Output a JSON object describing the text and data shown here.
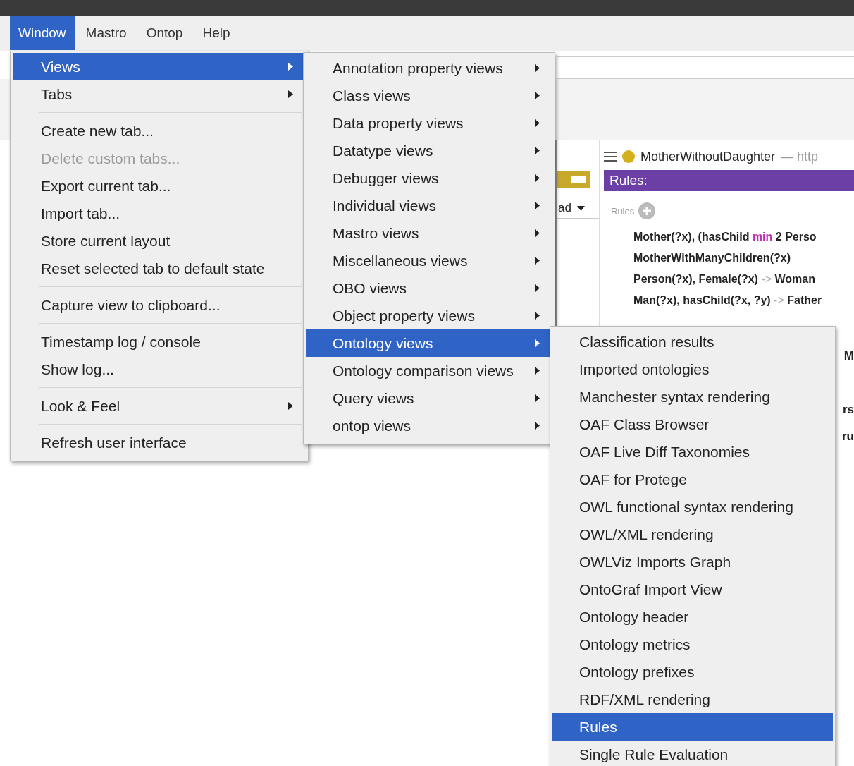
{
  "menubar": [
    {
      "label": "Window",
      "selected": true
    },
    {
      "label": "Mastro",
      "selected": false
    },
    {
      "label": "Ontop",
      "selected": false
    },
    {
      "label": "Help",
      "selected": false
    }
  ],
  "background": {
    "dropdown": "ad",
    "panel": {
      "title": "MotherWithoutDaughter",
      "title_suffix": "— http",
      "header": "Rules:",
      "section_label": "Rules",
      "rules": [
        {
          "parts": [
            {
              "text": "Mother(?x), (hasChild ",
              "kind": "plain"
            },
            {
              "text": "min",
              "kind": "keyword"
            },
            {
              "text": " 2 Perso",
              "kind": "plain"
            }
          ]
        },
        {
          "parts": [
            {
              "text": "MotherWithManyChildren(?x)",
              "kind": "plain"
            }
          ]
        },
        {
          "parts": [
            {
              "text": "Person(?x), Female(?x)",
              "kind": "plain"
            },
            {
              "text": " -> ",
              "kind": "arrow"
            },
            {
              "text": "Woman",
              "kind": "plain"
            }
          ]
        },
        {
          "parts": [
            {
              "text": "Man(?x), hasChild(?x, ?y)",
              "kind": "plain"
            },
            {
              "text": " -> ",
              "kind": "arrow"
            },
            {
              "text": "Father",
              "kind": "plain"
            }
          ]
        }
      ],
      "hidden_fragments": [
        "M",
        "rs",
        "ru"
      ]
    }
  },
  "menus": [
    {
      "items": [
        {
          "kind": "item",
          "label": "Views",
          "submenu": true,
          "selected": true,
          "disabled": false
        },
        {
          "kind": "item",
          "label": "Tabs",
          "submenu": true,
          "selected": false,
          "disabled": false
        },
        {
          "kind": "separator"
        },
        {
          "kind": "item",
          "label": "Create new tab...",
          "submenu": false,
          "selected": false,
          "disabled": false
        },
        {
          "kind": "item",
          "label": "Delete custom tabs...",
          "submenu": false,
          "selected": false,
          "disabled": true
        },
        {
          "kind": "item",
          "label": "Export current tab...",
          "submenu": false,
          "selected": false,
          "disabled": false
        },
        {
          "kind": "item",
          "label": "Import tab...",
          "submenu": false,
          "selected": false,
          "disabled": false
        },
        {
          "kind": "item",
          "label": "Store current layout",
          "submenu": false,
          "selected": false,
          "disabled": false
        },
        {
          "kind": "item",
          "label": "Reset selected tab to default state",
          "submenu": false,
          "selected": false,
          "disabled": false
        },
        {
          "kind": "separator"
        },
        {
          "kind": "item",
          "label": "Capture view to clipboard...",
          "submenu": false,
          "selected": false,
          "disabled": false
        },
        {
          "kind": "separator"
        },
        {
          "kind": "item",
          "label": "Timestamp log / console",
          "submenu": false,
          "selected": false,
          "disabled": false
        },
        {
          "kind": "item",
          "label": "Show log...",
          "submenu": false,
          "selected": false,
          "disabled": false
        },
        {
          "kind": "separator"
        },
        {
          "kind": "item",
          "label": "Look & Feel",
          "submenu": true,
          "selected": false,
          "disabled": false
        },
        {
          "kind": "separator"
        },
        {
          "kind": "item",
          "label": "Refresh user interface",
          "submenu": false,
          "selected": false,
          "disabled": false
        }
      ]
    },
    {
      "items": [
        {
          "kind": "item",
          "label": "Annotation property views",
          "submenu": true,
          "selected": false,
          "disabled": false
        },
        {
          "kind": "item",
          "label": "Class views",
          "submenu": true,
          "selected": false,
          "disabled": false
        },
        {
          "kind": "item",
          "label": "Data property views",
          "submenu": true,
          "selected": false,
          "disabled": false
        },
        {
          "kind": "item",
          "label": "Datatype views",
          "submenu": true,
          "selected": false,
          "disabled": false
        },
        {
          "kind": "item",
          "label": "Debugger views",
          "submenu": true,
          "selected": false,
          "disabled": false
        },
        {
          "kind": "item",
          "label": "Individual views",
          "submenu": true,
          "selected": false,
          "disabled": false
        },
        {
          "kind": "item",
          "label": "Mastro views",
          "submenu": true,
          "selected": false,
          "disabled": false
        },
        {
          "kind": "item",
          "label": "Miscellaneous views",
          "submenu": true,
          "selected": false,
          "disabled": false
        },
        {
          "kind": "item",
          "label": "OBO views",
          "submenu": true,
          "selected": false,
          "disabled": false
        },
        {
          "kind": "item",
          "label": "Object property views",
          "submenu": true,
          "selected": false,
          "disabled": false
        },
        {
          "kind": "item",
          "label": "Ontology views",
          "submenu": true,
          "selected": true,
          "disabled": false
        },
        {
          "kind": "item",
          "label": "Ontology comparison views",
          "submenu": true,
          "selected": false,
          "disabled": false
        },
        {
          "kind": "item",
          "label": "Query views",
          "submenu": true,
          "selected": false,
          "disabled": false
        },
        {
          "kind": "item",
          "label": "ontop views",
          "submenu": true,
          "selected": false,
          "disabled": false
        }
      ]
    },
    {
      "items": [
        {
          "kind": "item",
          "label": "Classification results",
          "submenu": false,
          "selected": false,
          "disabled": false
        },
        {
          "kind": "item",
          "label": "Imported ontologies",
          "submenu": false,
          "selected": false,
          "disabled": false
        },
        {
          "kind": "item",
          "label": "Manchester syntax rendering",
          "submenu": false,
          "selected": false,
          "disabled": false
        },
        {
          "kind": "item",
          "label": "OAF Class Browser",
          "submenu": false,
          "selected": false,
          "disabled": false
        },
        {
          "kind": "item",
          "label": "OAF Live Diff Taxonomies",
          "submenu": false,
          "selected": false,
          "disabled": false
        },
        {
          "kind": "item",
          "label": "OAF for Protege",
          "submenu": false,
          "selected": false,
          "disabled": false
        },
        {
          "kind": "item",
          "label": "OWL functional syntax rendering",
          "submenu": false,
          "selected": false,
          "disabled": false
        },
        {
          "kind": "item",
          "label": "OWL/XML rendering",
          "submenu": false,
          "selected": false,
          "disabled": false
        },
        {
          "kind": "item",
          "label": "OWLViz Imports Graph",
          "submenu": false,
          "selected": false,
          "disabled": false
        },
        {
          "kind": "item",
          "label": "OntoGraf Import View",
          "submenu": false,
          "selected": false,
          "disabled": false
        },
        {
          "kind": "item",
          "label": "Ontology header",
          "submenu": false,
          "selected": false,
          "disabled": false
        },
        {
          "kind": "item",
          "label": "Ontology metrics",
          "submenu": false,
          "selected": false,
          "disabled": false
        },
        {
          "kind": "item",
          "label": "Ontology prefixes",
          "submenu": false,
          "selected": false,
          "disabled": false
        },
        {
          "kind": "item",
          "label": "RDF/XML rendering",
          "submenu": false,
          "selected": false,
          "disabled": false
        },
        {
          "kind": "item",
          "label": "Rules",
          "submenu": false,
          "selected": true,
          "disabled": false
        },
        {
          "kind": "item",
          "label": "Single Rule Evaluation",
          "submenu": false,
          "selected": false,
          "disabled": false
        }
      ]
    }
  ]
}
